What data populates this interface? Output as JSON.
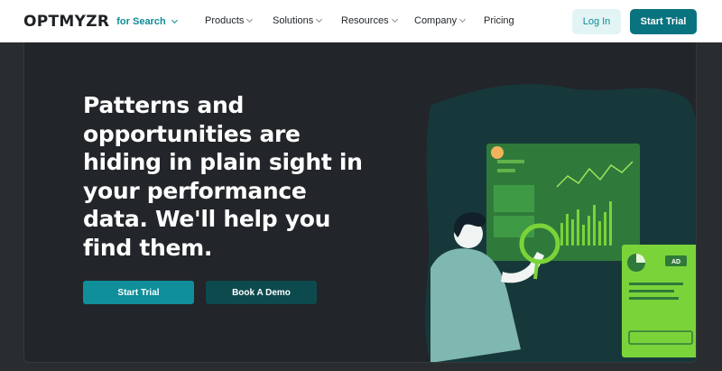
{
  "header": {
    "logo": {
      "brand": "OPTMYZR",
      "product_selector": "for Search"
    },
    "nav": [
      {
        "label": "Products",
        "has_dropdown": true
      },
      {
        "label": "Solutions",
        "has_dropdown": true
      },
      {
        "label": "Resources",
        "has_dropdown": true
      },
      {
        "label": "Company",
        "has_dropdown": true
      },
      {
        "label": "Pricing",
        "has_dropdown": false
      }
    ],
    "login_label": "Log In",
    "start_trial_label": "Start Trial"
  },
  "hero": {
    "headline_lines": [
      "Patterns and",
      "opportunities are",
      "hiding in plain sight in",
      "your performance",
      "data. We'll help you",
      "find them."
    ],
    "primary_cta": "Start Trial",
    "secondary_cta": "Book A Demo",
    "illustration": {
      "badge": "AD"
    }
  },
  "colors": {
    "brand_teal": "#0a7380",
    "accent_teal": "#0f8c96",
    "hero_bg": "#222529",
    "illustration_green": "#7bd33a"
  },
  "icons": {
    "dropdown": "chevron-down-icon",
    "magnifier": "magnifying-glass-icon",
    "pie": "pie-chart-icon"
  }
}
